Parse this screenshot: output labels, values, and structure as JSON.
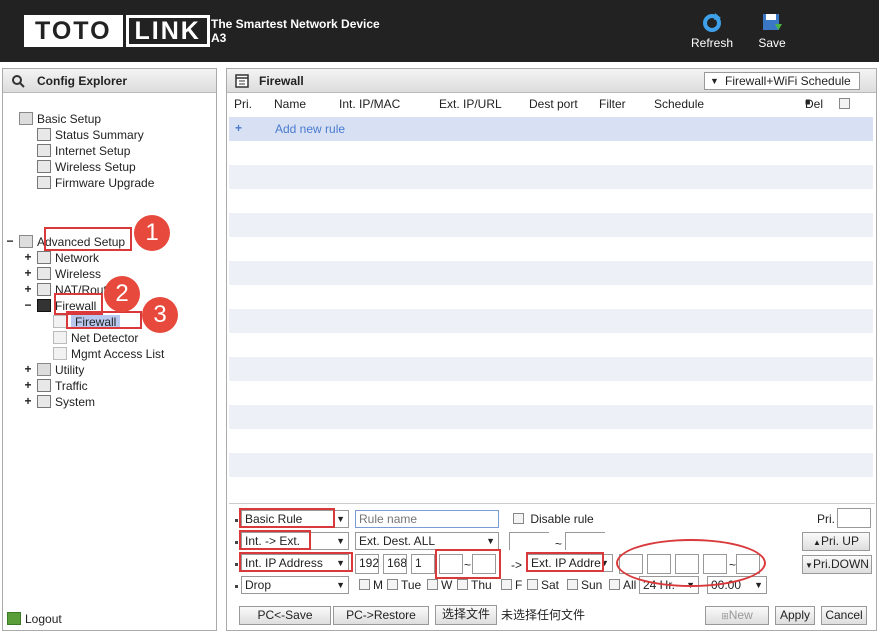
{
  "header": {
    "logo_left": "TOTO",
    "logo_right": "LINK",
    "slogan": "The Smartest Network Device",
    "model": "A3",
    "refresh_label": "Refresh",
    "save_label": "Save"
  },
  "left": {
    "title": "Config Explorer",
    "basic_setup": "Basic Setup",
    "basic_items": [
      "Status Summary",
      "Internet Setup",
      "Wireless Setup",
      "Firmware Upgrade"
    ],
    "advanced_setup": "Advanced Setup",
    "advanced_items": [
      "Network",
      "Wireless",
      "NAT/Routing",
      "Firewall"
    ],
    "firewall_items": [
      "Firewall",
      "Net Detector",
      "Mgmt Access List"
    ],
    "other_items": [
      "Utility",
      "Traffic",
      "System"
    ],
    "logout": "Logout"
  },
  "main": {
    "title": "Firewall",
    "schedule_select": "Firewall+WiFi Schedule",
    "columns": [
      "Pri.",
      "Name",
      "Int. IP/MAC",
      "Ext. IP/URL",
      "Dest port",
      "Filter",
      "Schedule",
      "Del"
    ],
    "add_rule": "Add new rule"
  },
  "form": {
    "rule_type": "Basic Rule",
    "rule_name_placeholder": "Rule name",
    "disable_rule": "Disable rule",
    "pri_label": "Pri.",
    "direction": "Int. -> Ext.",
    "dest": "Ext. Dest. ALL",
    "pri_up": "Pri. UP",
    "int_ip_type": "Int. IP Address",
    "ip1": "192",
    "ip2": "168",
    "ip3": "1",
    "tilde": "~",
    "arrow": "->",
    "ext_ip_type": "Ext. IP Addre",
    "pri_down": "Pri.DOWN",
    "action": "Drop",
    "days": [
      "M",
      "Tue",
      "W",
      "Thu",
      "F",
      "Sat",
      "Sun",
      "All"
    ],
    "hours": "24 Hr.",
    "time": "00:00",
    "pc_save": "PC<-Save",
    "pc_restore": "PC->Restore",
    "choose_file": "选择文件",
    "no_file": "未选择任何文件",
    "new": "New",
    "apply": "Apply",
    "cancel": "Cancel"
  },
  "annotations": [
    "1",
    "2",
    "3"
  ]
}
